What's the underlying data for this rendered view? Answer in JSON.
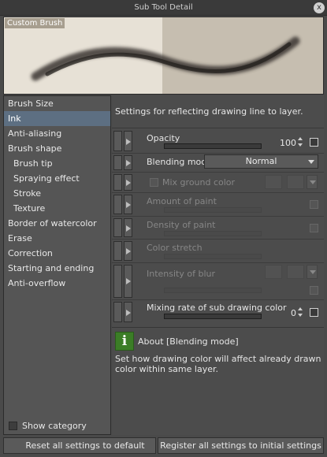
{
  "window": {
    "title": "Sub Tool Detail",
    "close_glyph": "x"
  },
  "preview": {
    "label": "Custom Brush"
  },
  "sidebar": {
    "items": [
      {
        "label": "Brush Size",
        "sub": false,
        "selected": false
      },
      {
        "label": "Ink",
        "sub": false,
        "selected": true
      },
      {
        "label": "Anti-aliasing",
        "sub": false,
        "selected": false
      },
      {
        "label": "Brush shape",
        "sub": false,
        "selected": false
      },
      {
        "label": "Brush tip",
        "sub": true,
        "selected": false
      },
      {
        "label": "Spraying effect",
        "sub": true,
        "selected": false
      },
      {
        "label": "Stroke",
        "sub": true,
        "selected": false
      },
      {
        "label": "Texture",
        "sub": true,
        "selected": false
      },
      {
        "label": "Border of watercolor",
        "sub": false,
        "selected": false
      },
      {
        "label": "Erase",
        "sub": false,
        "selected": false
      },
      {
        "label": "Correction",
        "sub": false,
        "selected": false
      },
      {
        "label": "Starting and ending",
        "sub": false,
        "selected": false
      },
      {
        "label": "Anti-overflow",
        "sub": false,
        "selected": false
      }
    ],
    "show_category": "Show category"
  },
  "main": {
    "description": "Settings for reflecting drawing line to layer.",
    "properties": {
      "opacity": {
        "label": "Opacity",
        "value": "100",
        "level": 1.0
      },
      "blending_mode": {
        "label": "Blending mode",
        "selected": "Normal"
      },
      "mix_ground_color": {
        "label": "Mix ground color"
      },
      "amount_of_paint": {
        "label": "Amount of paint"
      },
      "density_of_paint": {
        "label": "Density of paint"
      },
      "color_stretch": {
        "label": "Color stretch"
      },
      "intensity_of_blur": {
        "label": "Intensity of blur"
      },
      "mixing_rate": {
        "label": "Mixing rate of sub drawing color",
        "value": "0",
        "level": 0.0
      }
    },
    "about": {
      "title": "About [Blending mode]",
      "text": "Set how drawing color will affect already drawn color within same layer.",
      "icon": "info-icon"
    }
  },
  "footer": {
    "reset_label": "Reset all settings to default",
    "register_label": "Register all settings to initial settings"
  },
  "colors": {
    "selection": "#5d6f82",
    "info_icon": "#3b7d26"
  }
}
